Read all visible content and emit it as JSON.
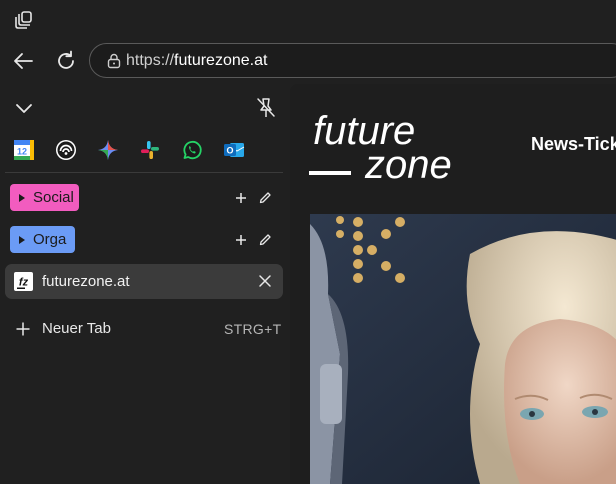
{
  "toolbar": {
    "workspaces_icon": "workspaces-icon",
    "back_icon": "arrow-left-icon",
    "reload_icon": "reload-icon"
  },
  "address_bar": {
    "scheme": "https://",
    "host": "futurezone.at"
  },
  "sidebar": {
    "pinned_apps": [
      {
        "name": "calendar",
        "label": "12"
      },
      {
        "name": "podcast"
      },
      {
        "name": "gemini"
      },
      {
        "name": "slack"
      },
      {
        "name": "whatsapp"
      },
      {
        "name": "outlook",
        "label": "O"
      }
    ],
    "groups": [
      {
        "label": "Social",
        "color": "#f25cbf"
      },
      {
        "label": "Orga",
        "color": "#6b9bf5"
      }
    ],
    "tabs": [
      {
        "title": "futurezone.at",
        "favicon": "fz"
      }
    ],
    "new_tab": {
      "label": "Neuer Tab",
      "shortcut": "STRG+T"
    }
  },
  "page": {
    "logo_line1": "future",
    "logo_line2": "zone",
    "nav_link": "News-Tick"
  }
}
